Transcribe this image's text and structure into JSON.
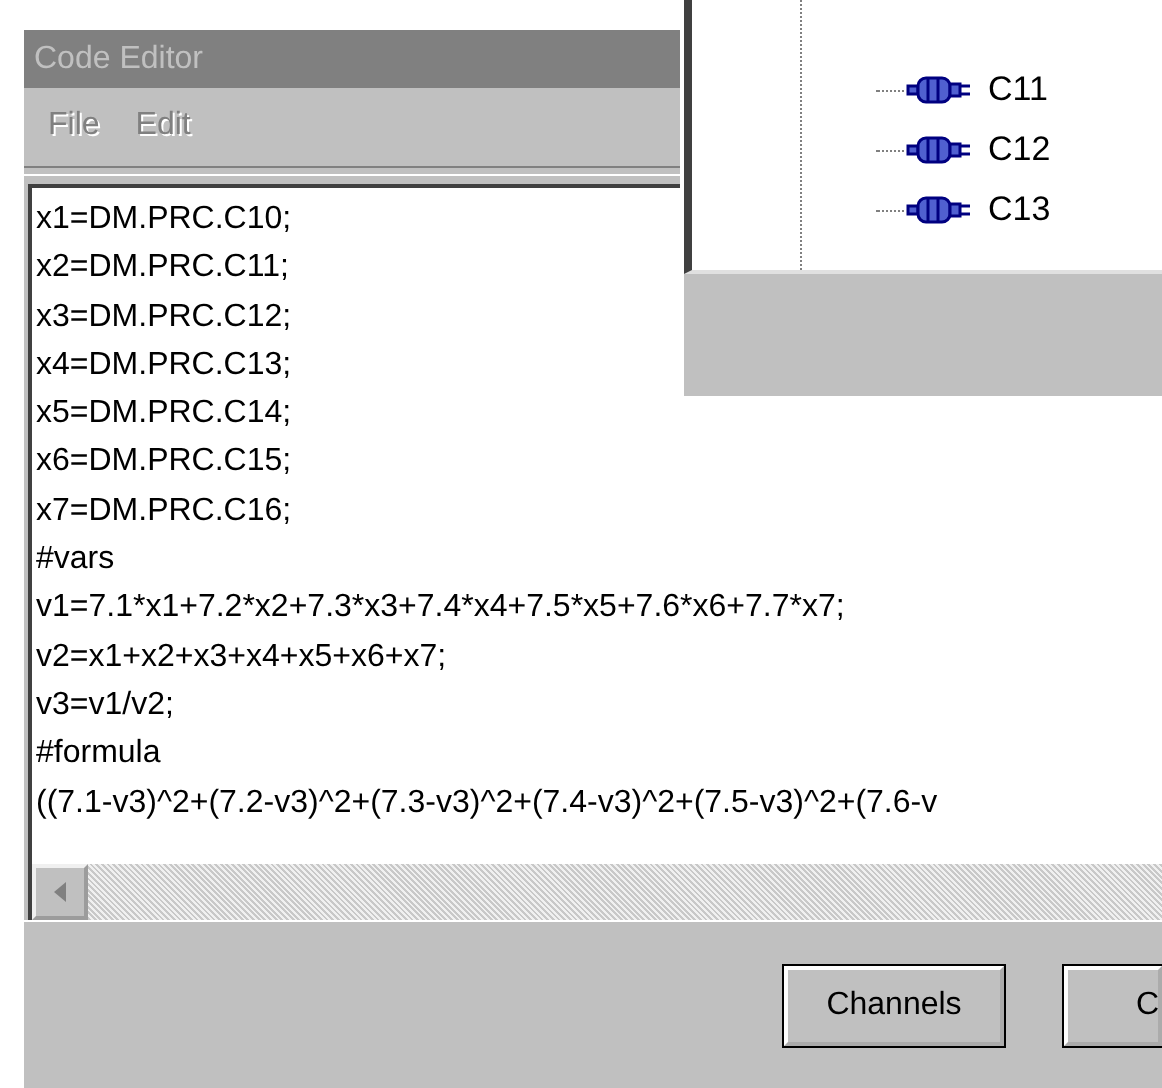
{
  "editor": {
    "title": "Code Editor",
    "active": false,
    "menu": [
      {
        "label": "File",
        "disabled": true
      },
      {
        "label": "Edit",
        "disabled": true
      }
    ],
    "code_lines": [
      "x1=DM.PRC.C10;",
      "x2=DM.PRC.C11;",
      "x3=DM.PRC.C12;",
      "x4=DM.PRC.C13;",
      "x5=DM.PRC.C14;",
      "x6=DM.PRC.C15;",
      "x7=DM.PRC.C16;",
      "#vars",
      "v1=7.1*x1+7.2*x2+7.3*x3+7.4*x4+7.5*x5+7.6*x6+7.7*x7;",
      "v2=x1+x2+x3+x4+x5+x6+x7;",
      "v3=v1/v2;",
      "#formula",
      "((7.1-v3)^2+(7.2-v3)^2+(7.3-v3)^2+(7.4-v3)^2+(7.5-v3)^2+(7.6-v"
    ],
    "buttons": [
      "Channels",
      "C"
    ]
  },
  "channel_tree": {
    "items": [
      "C11",
      "C12",
      "C13"
    ]
  }
}
